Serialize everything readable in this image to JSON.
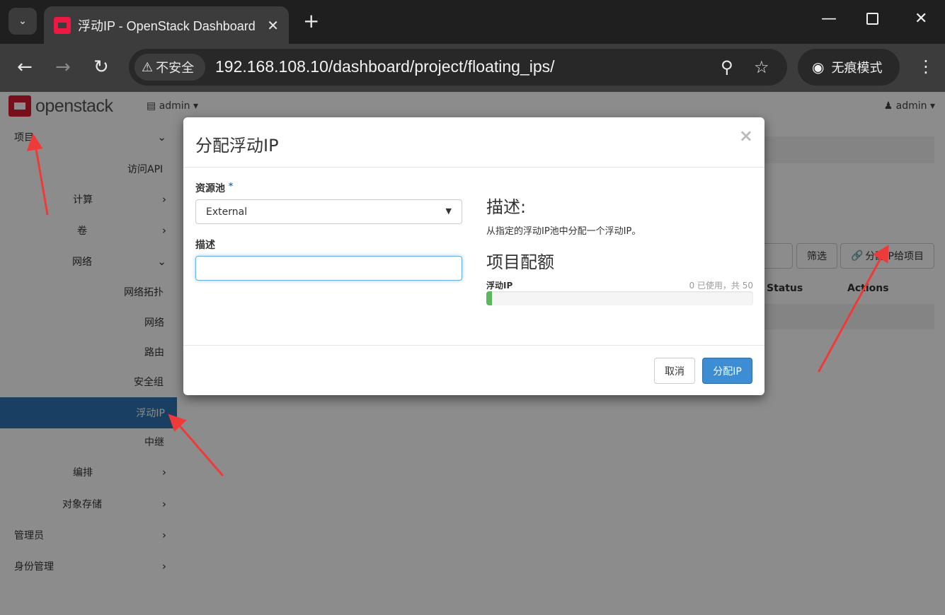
{
  "browser": {
    "tab_title": "浮动IP - OpenStack Dashboard",
    "security_label": "不安全",
    "url": "192.168.108.10/dashboard/project/floating_ips/",
    "incognito_label": "无痕模式"
  },
  "header": {
    "logo_text": "openstack",
    "project_selector": "admin",
    "user_menu": "admin"
  },
  "sidebar": {
    "items": [
      {
        "label": "项目"
      },
      {
        "label": "访问API"
      },
      {
        "label": "计算"
      },
      {
        "label": "卷"
      },
      {
        "label": "网络"
      },
      {
        "label": "网络拓扑"
      },
      {
        "label": "网络"
      },
      {
        "label": "路由"
      },
      {
        "label": "安全组"
      },
      {
        "label": "浮动IP"
      },
      {
        "label": "中继"
      },
      {
        "label": "编排"
      },
      {
        "label": "对象存储"
      },
      {
        "label": "管理员"
      },
      {
        "label": "身份管理"
      }
    ]
  },
  "content": {
    "filter_button": "筛选",
    "allocate_to_project_button": "分配IP给项目",
    "columns": [
      "Status",
      "Actions"
    ]
  },
  "modal": {
    "title": "分配浮动IP",
    "pool_label": "资源池",
    "pool_required_mark": "*",
    "pool_value": "External",
    "description_label": "描述",
    "description_value": "",
    "help_heading": "描述:",
    "help_text": "从指定的浮动IP池中分配一个浮动IP。",
    "quota_heading": "项目配额",
    "quota_item_label": "浮动IP",
    "quota_usage_text": "0 已使用，共 50",
    "quota_used": 0,
    "quota_total": 50,
    "cancel_button": "取消",
    "submit_button": "分配IP"
  },
  "colors": {
    "accent": "#2e74b5",
    "primary_button": "#3c8dd4",
    "progress": "#5cb85c",
    "annotation_arrow": "#ef3a3a"
  }
}
